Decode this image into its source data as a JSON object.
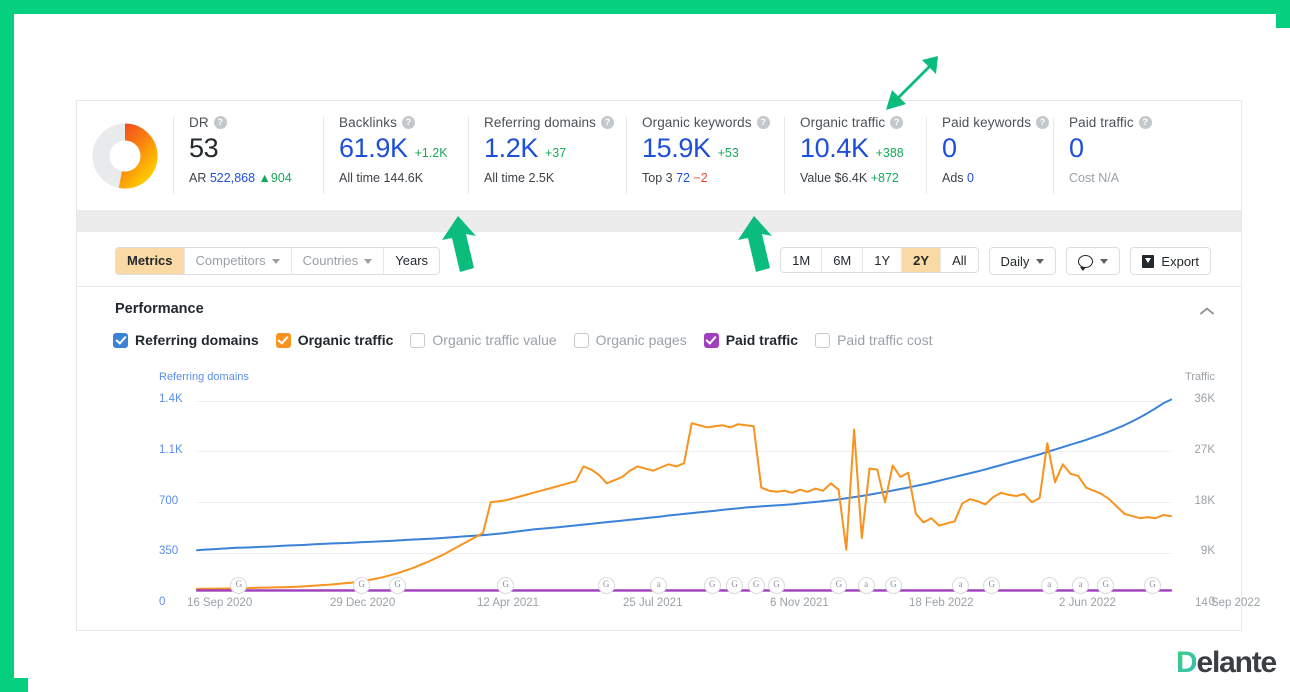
{
  "frame": {
    "accent_color": "#06cf7f"
  },
  "metrics": [
    {
      "name": "dr",
      "label": "DR",
      "value": "53",
      "value_style": "dark",
      "delta": "",
      "sub_label": "AR",
      "sub_value": "522,868",
      "sub_extra": "904",
      "sub_extra_kind": "up",
      "donut_percent": 53
    },
    {
      "name": "backlinks",
      "label": "Backlinks",
      "value": "61.9K",
      "value_style": "blue",
      "delta": "+1.2K",
      "delta_kind": "pos",
      "sub_label": "All time",
      "sub_value": "144.6K",
      "sub_value_kind": "dark"
    },
    {
      "name": "referring-domains",
      "label": "Referring domains",
      "value": "1.2K",
      "value_style": "blue",
      "delta": "+37",
      "delta_kind": "pos",
      "sub_label": "All time",
      "sub_value": "2.5K",
      "sub_value_kind": "dark"
    },
    {
      "name": "organic-keywords",
      "label": "Organic keywords",
      "value": "15.9K",
      "value_style": "blue",
      "delta": "+53",
      "delta_kind": "pos",
      "sub_label": "Top 3",
      "sub_value": "72",
      "sub_value_kind": "blue",
      "sub_extra": "−2",
      "sub_extra_kind": "down"
    },
    {
      "name": "organic-traffic",
      "label": "Organic traffic",
      "value": "10.4K",
      "value_style": "blue",
      "delta": "+388",
      "delta_kind": "pos",
      "sub_label": "Value",
      "sub_value": "$6.4K",
      "sub_value_kind": "dark",
      "sub_extra": "+872",
      "sub_extra_kind": "up"
    },
    {
      "name": "paid-keywords",
      "label": "Paid keywords",
      "value": "0",
      "value_style": "blue",
      "delta": "",
      "sub_label": "Ads",
      "sub_value": "0",
      "sub_value_kind": "blue"
    },
    {
      "name": "paid-traffic",
      "label": "Paid traffic",
      "value": "0",
      "value_style": "blue",
      "delta": "",
      "sub_label": "Cost",
      "sub_value": "N/A",
      "sub_value_kind": "muted",
      "sub_label_muted": true
    }
  ],
  "toolbar": {
    "tabs": [
      {
        "label": "Metrics",
        "active": true,
        "caret": false
      },
      {
        "label": "Competitors",
        "active": false,
        "caret": true
      },
      {
        "label": "Countries",
        "active": false,
        "caret": true
      },
      {
        "label": "Years",
        "active": false,
        "caret": false,
        "dark": true
      }
    ],
    "ranges": [
      {
        "label": "1M",
        "active": false
      },
      {
        "label": "6M",
        "active": false
      },
      {
        "label": "1Y",
        "active": false
      },
      {
        "label": "2Y",
        "active": true
      },
      {
        "label": "All",
        "active": false
      }
    ],
    "granularity": "Daily",
    "export_label": "Export"
  },
  "panel": {
    "title": "Performance",
    "collapse_icon": "chevron-up-icon",
    "legend": [
      {
        "label": "Referring domains",
        "checked": true,
        "color": "blue"
      },
      {
        "label": "Organic traffic",
        "checked": true,
        "color": "orange"
      },
      {
        "label": "Organic traffic value",
        "checked": false,
        "color": "none"
      },
      {
        "label": "Organic pages",
        "checked": false,
        "color": "none"
      },
      {
        "label": "Paid traffic",
        "checked": true,
        "color": "purple"
      },
      {
        "label": "Paid traffic cost",
        "checked": false,
        "color": "none"
      }
    ]
  },
  "chart_data": {
    "type": "line",
    "title": "Performance",
    "left_axis_label": "Referring domains",
    "right_axis_label": "Traffic",
    "left_ticks": [
      "1.4K",
      "1.1K",
      "700",
      "350",
      "0"
    ],
    "left_tick_values": [
      1400,
      1100,
      700,
      350,
      0
    ],
    "right_ticks": [
      "36K",
      "27K",
      "18K",
      "9K",
      "0"
    ],
    "right_tick_values": [
      36000,
      27000,
      18000,
      9000,
      0
    ],
    "ylim_left": [
      0,
      1575
    ],
    "ylim_right": [
      0,
      40500
    ],
    "grid": true,
    "legend_position": "top",
    "x_tick_labels": [
      "16 Sep 2020",
      "29 Dec 2020",
      "12 Apr 2021",
      "25 Jul 2021",
      "6 Nov 2021",
      "18 Feb 2022",
      "2 Jun 2022",
      "14 Sep 2022"
    ],
    "x_range": [
      "16 Sep 2020",
      "14 Sep 2022"
    ],
    "series": [
      {
        "name": "Referring domains",
        "color": "#3b82d9",
        "axis": "left",
        "values": [
          300,
          305,
          308,
          312,
          315,
          318,
          320,
          322,
          325,
          327,
          330,
          333,
          336,
          338,
          341,
          344,
          347,
          350,
          352,
          354,
          357,
          360,
          362,
          365,
          368,
          371,
          374,
          377,
          380,
          383,
          386,
          390,
          394,
          398,
          402,
          406,
          410,
          415,
          420,
          426,
          433,
          440,
          448,
          455,
          460,
          465,
          470,
          476,
          482,
          488,
          494,
          500,
          506,
          512,
          518,
          524,
          530,
          536,
          542,
          548,
          556,
          562,
          568,
          574,
          580,
          586,
          592,
          598,
          604,
          610,
          616,
          620,
          624,
          628,
          632,
          636,
          640,
          646,
          652,
          658,
          664,
          670,
          678,
          686,
          695,
          704,
          714,
          724,
          734,
          745,
          756,
          768,
          780,
          792,
          806,
          820,
          834,
          848,
          862,
          876,
          890,
          906,
          922,
          938,
          954,
          970,
          986,
          1002,
          1020,
          1038,
          1056,
          1074,
          1092,
          1110,
          1130,
          1150,
          1172,
          1196,
          1220,
          1248,
          1278,
          1310,
          1345,
          1382,
          1410
        ]
      },
      {
        "name": "Organic traffic",
        "color": "#f7931e",
        "axis": "right",
        "values": [
          400,
          420,
          440,
          460,
          480,
          500,
          520,
          560,
          600,
          640,
          680,
          720,
          760,
          820,
          900,
          980,
          1080,
          1180,
          1300,
          1450,
          1600,
          1800,
          2000,
          2300,
          2600,
          3000,
          3400,
          3900,
          4400,
          5000,
          5600,
          6300,
          7000,
          7800,
          8600,
          9400,
          10200,
          11000,
          16800,
          17000,
          17200,
          17600,
          18000,
          18400,
          18800,
          19200,
          19600,
          20000,
          20400,
          20800,
          23600,
          23000,
          22000,
          20400,
          21000,
          21600,
          22800,
          23600,
          23200,
          22800,
          23400,
          24000,
          23600,
          24200,
          31800,
          31400,
          31000,
          31200,
          31400,
          31000,
          31600,
          31400,
          31200,
          19600,
          19000,
          18800,
          19000,
          18600,
          19200,
          18800,
          19400,
          19000,
          20400,
          19200,
          7800,
          30600,
          10000,
          23200,
          23000,
          16800,
          23800,
          21600,
          22400,
          14600,
          13000,
          13800,
          12400,
          12800,
          13200,
          16600,
          17400,
          17000,
          16400,
          17800,
          18600,
          18200,
          18000,
          18400,
          16800,
          17600,
          28000,
          20600,
          24000,
          22200,
          21800,
          19600,
          19000,
          18400,
          17400,
          16000,
          14600,
          14200,
          13800,
          14000,
          13800,
          14400,
          14200
        ]
      },
      {
        "name": "Paid traffic",
        "color": "#a13fbd",
        "axis": "right",
        "values": [
          120,
          120,
          120,
          120,
          120,
          120,
          120,
          120,
          120,
          120,
          120,
          120,
          120,
          120,
          120,
          120,
          120,
          120,
          120,
          120,
          120,
          120,
          120,
          120,
          120,
          120,
          120,
          120,
          120,
          120,
          120,
          120,
          120,
          120,
          120,
          120,
          120,
          120,
          120,
          120,
          120,
          120,
          120,
          120,
          120,
          120,
          120,
          120,
          120,
          120,
          120,
          120,
          120,
          120,
          120,
          120,
          120,
          120,
          120,
          120,
          120,
          120,
          120,
          120,
          120,
          120,
          120,
          120,
          120,
          120,
          120,
          120,
          120,
          120,
          120,
          120,
          120,
          120,
          120,
          120,
          120,
          120,
          120,
          120,
          120,
          120,
          120,
          120,
          120,
          120,
          120,
          120,
          120,
          120,
          120,
          120,
          120,
          120,
          120,
          120,
          120,
          120,
          120,
          120,
          120,
          120,
          120,
          120,
          120,
          120,
          120,
          120,
          120,
          120,
          120,
          120,
          120,
          120,
          120,
          120,
          120,
          120,
          120,
          120,
          120,
          120,
          120
        ]
      }
    ],
    "event_markers": [
      {
        "label": "G",
        "x_pct": 4.2
      },
      {
        "label": "G",
        "x_pct": 16.8
      },
      {
        "label": "G",
        "x_pct": 20.5
      },
      {
        "label": "G",
        "x_pct": 31.6
      },
      {
        "label": "G",
        "x_pct": 41.9
      },
      {
        "label": "a",
        "x_pct": 47.3
      },
      {
        "label": "G",
        "x_pct": 52.8
      },
      {
        "label": "G",
        "x_pct": 55.1
      },
      {
        "label": "G",
        "x_pct": 57.3
      },
      {
        "label": "G",
        "x_pct": 59.4
      },
      {
        "label": "G",
        "x_pct": 65.8
      },
      {
        "label": "a",
        "x_pct": 68.6
      },
      {
        "label": "G",
        "x_pct": 71.4
      },
      {
        "label": "a",
        "x_pct": 78.3
      },
      {
        "label": "G",
        "x_pct": 81.5
      },
      {
        "label": "a",
        "x_pct": 87.4
      },
      {
        "label": "a",
        "x_pct": 90.6
      },
      {
        "label": "G",
        "x_pct": 93.2
      },
      {
        "label": "G",
        "x_pct": 98.0
      }
    ]
  },
  "logo": {
    "initial": "D",
    "rest": "elante"
  }
}
